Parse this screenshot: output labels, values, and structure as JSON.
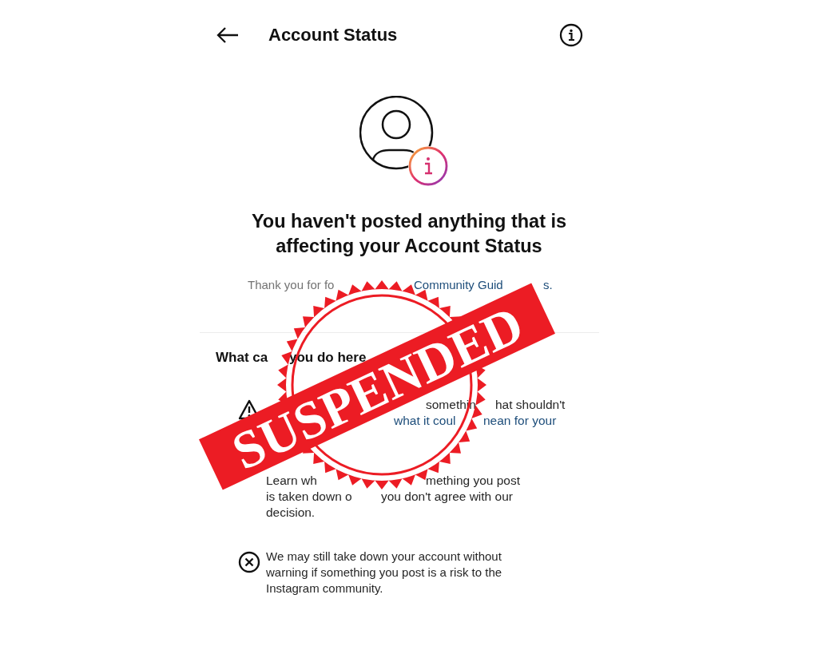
{
  "header": {
    "title": "Account Status"
  },
  "headline": "You haven't posted anything that is affecting your Account Status",
  "thanks": [
    {
      "text": "Thank you for fo",
      "kind": "plain"
    },
    {
      "text": "Community Guid",
      "kind": "link"
    },
    {
      "text": "s.",
      "kind": "link"
    }
  ],
  "heading": [
    {
      "text": "What ca",
      "kind": "bold"
    },
    {
      "text": "you do here",
      "kind": "bold"
    }
  ],
  "items": [
    {
      "kind": "warning",
      "lines": [
        [
          {
            "text": "somethin",
            "kind": "plain"
          },
          {
            "text": "hat shouldn't",
            "kind": "plain"
          }
        ],
        [
          {
            "text": "what it coul",
            "kind": "link"
          },
          {
            "text": "nean for your",
            "kind": "link"
          }
        ]
      ]
    },
    {
      "kind": "plain",
      "lines": [
        [
          {
            "text": "Learn wh",
            "kind": "plain"
          },
          {
            "text": "mething you post",
            "kind": "plain"
          }
        ],
        [
          {
            "text": "is taken down o",
            "kind": "plain"
          },
          {
            "text": "you don't agree with our",
            "kind": "plain"
          }
        ],
        [
          {
            "text": "decision.",
            "kind": "plain"
          }
        ]
      ]
    },
    {
      "kind": "cross",
      "text": "We may still take down your account without warning if something you post is a risk to the Instagram community."
    }
  ],
  "stamp": {
    "text": "SUSPENDED"
  }
}
